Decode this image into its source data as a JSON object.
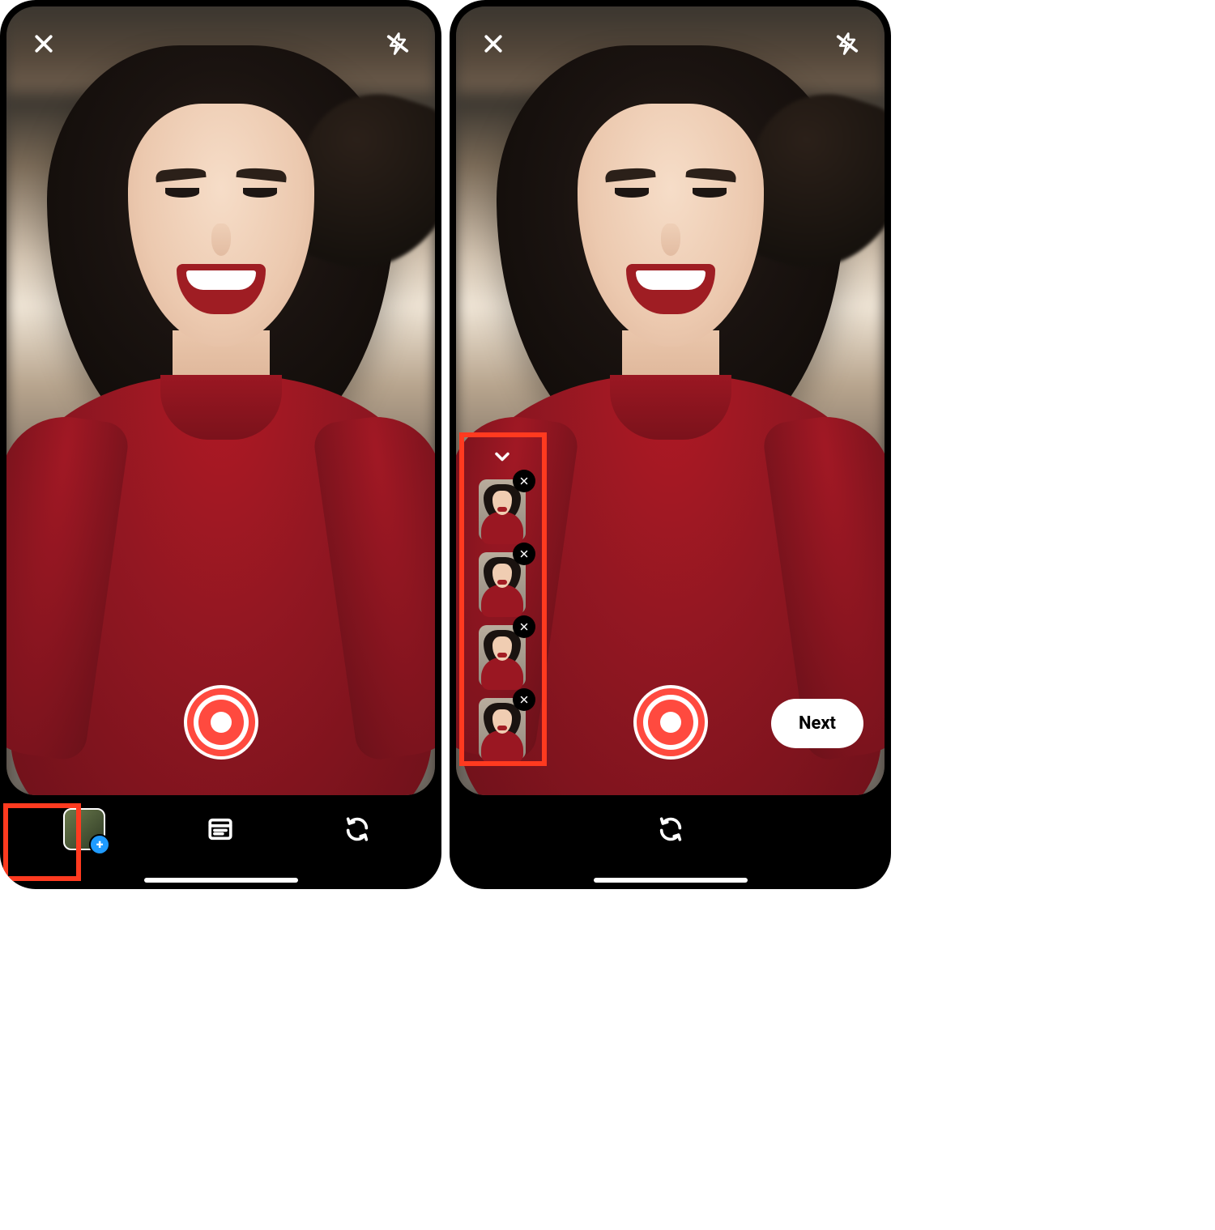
{
  "icons": {
    "close": "close-icon",
    "flash": "flash-off-icon",
    "gallery": "gallery-add-icon",
    "templates": "templates-icon",
    "flip": "flip-camera-icon",
    "collapse": "chevron-down-icon",
    "delete": "close-icon"
  },
  "shutter": {
    "state": "idle",
    "color": "#ff4a3f"
  },
  "next_button": {
    "label": "Next"
  },
  "gallery_plus_glyph": "+",
  "clips": [
    {
      "id": 1,
      "removable": true
    },
    {
      "id": 2,
      "removable": true
    },
    {
      "id": 3,
      "removable": true
    },
    {
      "id": 4,
      "removable": true
    }
  ],
  "highlights": {
    "left_gallery_button": true,
    "right_clip_stack": true
  }
}
